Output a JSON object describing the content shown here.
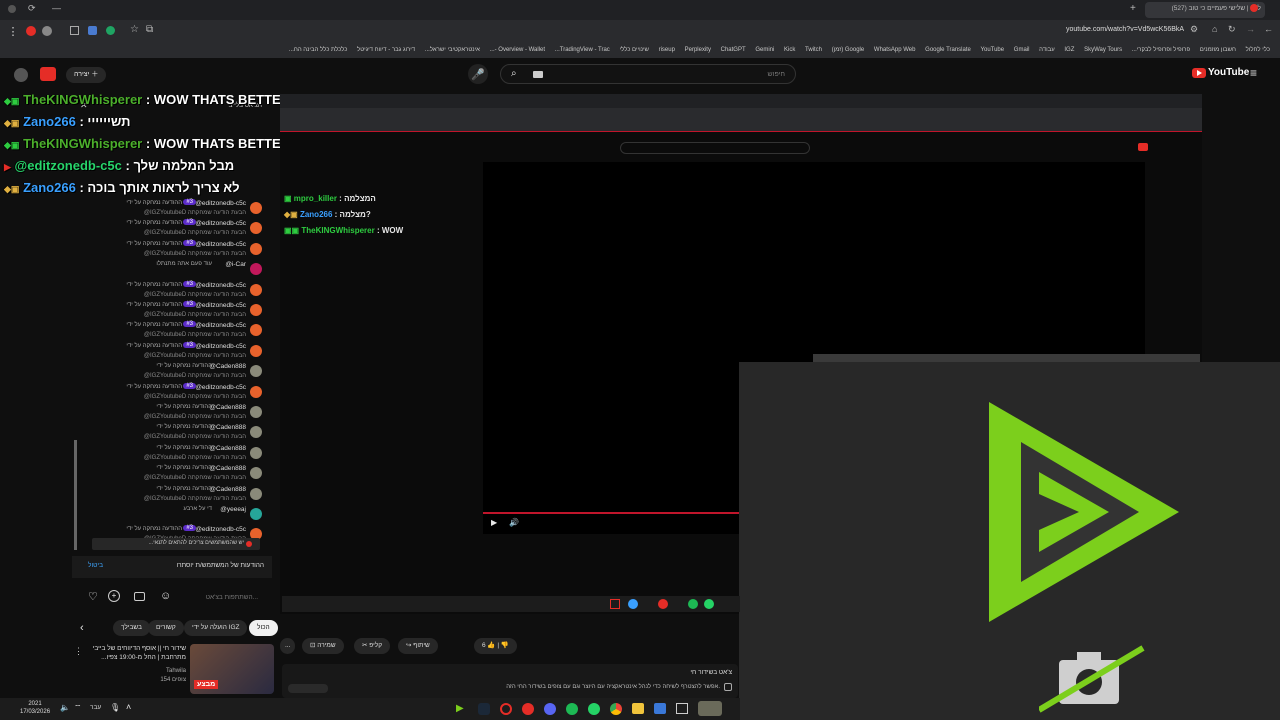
{
  "browser": {
    "tab_title": "לייב | שלישי פעמיים כי טוב (527)",
    "url": "youtube.com/watch?v=Vd5wcK56BkA",
    "bookmarks": [
      "כלי לחלול",
      "חשבון מוזמנים",
      "פרופיל ופרופיל לבקרי...",
      "SkyWay Tours",
      "IGZ",
      "עבודה",
      "Gmail",
      "YouTube",
      "Google Translate",
      "WhatsApp Web",
      "Google (זמן)",
      "Twitch",
      "Kick",
      "Gemini",
      "ChatGPT",
      "Perplexity",
      "riseup",
      "שינויים כללי",
      "TradingView - Trac...",
      "Overview - Wallet -...",
      "אינטראקטיבי ישראל...",
      "דירוג גבר - דיווח דיגיטל",
      "כלכלת כלל הבינה הח..."
    ]
  },
  "youtube": {
    "logo_text": "YouTube",
    "search_placeholder": "חיפוש",
    "create_label": "יצירה"
  },
  "overlay_chat": [
    {
      "name": "TheKINGWhisperer",
      "text": ": WOW THATS BETTER"
    },
    {
      "name": "Zano266",
      "text": ": תשיייייי"
    },
    {
      "name": "TheKINGWhisperer",
      "text": ": WOW THATS BETTER"
    },
    {
      "name": "@editzonedb-c5c",
      "text": ": מבל המלמה שלך"
    },
    {
      "name": "Zano266",
      "text": ": לא צריך לראות אותך בוכה"
    }
  ],
  "chat": {
    "header": "הצ'אט בלייב",
    "messages": [
      {
        "name": "@editzonedb-c5c",
        "badge": "#3",
        "line1": "ההודעה נמחקה על ידי",
        "line2": "@IGZYoutubeD הבעת הודעה שמחקתה"
      },
      {
        "name": "@editzonedb-c5c",
        "badge": "#3",
        "line1": "ההודעה נמחקה על ידי",
        "line2": "@IGZYoutubeD הבעת הודעה שמחקתה"
      },
      {
        "name": "@editzonedb-c5c",
        "badge": "#3",
        "line1": "ההודעה נמחקה על ידי",
        "line2": "@IGZYoutubeD הבעת הודעה שמחקתה"
      },
      {
        "name": "@i-Car",
        "badge": "",
        "line1": "עוד פעם אתה מתנתלו",
        "line2": ""
      },
      {
        "name": "@editzonedb-c5c",
        "badge": "#3",
        "line1": "ההודעה נמחקה על ידי",
        "line2": "@IGZYoutubeD הבעת הודעה שמחקתה"
      },
      {
        "name": "@editzonedb-c5c",
        "badge": "#3",
        "line1": "ההודעה נמחקה על ידי",
        "line2": "@IGZYoutubeD הבעת הודעה שמחקתה"
      },
      {
        "name": "@editzonedb-c5c",
        "badge": "#3",
        "line1": "ההודעה נמחקה על ידי",
        "line2": "@IGZYoutubeD הבעת הודעה שמחקתה"
      },
      {
        "name": "@editzonedb-c5c",
        "badge": "#3",
        "line1": "ההודעה נמחקה על ידי",
        "line2": "@IGZYoutubeD הבעת הודעה שמחקתה"
      },
      {
        "name": "@Caden888",
        "badge": "",
        "line1": "ההודעה נמחקה על ידי",
        "line2": "@IGZYoutubeD הבעת הודעה שמחקתה"
      },
      {
        "name": "@editzonedb-c5c",
        "badge": "#3",
        "line1": "ההודעה נמחקה על ידי",
        "line2": "@IGZYoutubeD הבעת הודעה שמחקתה"
      },
      {
        "name": "@Caden888",
        "badge": "",
        "line1": "ההודעה נמחקה על ידי",
        "line2": "@IGZYoutubeD הבעת הודעה שמחקתה"
      },
      {
        "name": "@Caden888",
        "badge": "",
        "line1": "ההודעה נמחקה על ידי",
        "line2": "@IGZYoutubeD הבעת הודעה שמחקתה"
      },
      {
        "name": "@Caden888",
        "badge": "",
        "line1": "ההודעה נמחקה על ידי",
        "line2": "@IGZYoutubeD הבעת הודעה שמחקתה"
      },
      {
        "name": "@Caden888",
        "badge": "",
        "line1": "ההודעה נמחקה על ידי",
        "line2": "@IGZYoutubeD הבעת הודעה שמחקתה"
      },
      {
        "name": "@Caden888",
        "badge": "",
        "line1": "ההודעה נמחקה על ידי",
        "line2": "@IGZYoutubeD הבעת הודעה שמחקתה"
      },
      {
        "name": "@yeeeaj",
        "badge": "",
        "line1": "די על ארבע",
        "line2": ""
      },
      {
        "name": "@editzonedb-c5c",
        "badge": "#3",
        "line1": "ההודעה נמחקה על ידי",
        "line2": "@IGZYoutubeD הבעת הודעה שמחקתה"
      }
    ],
    "banner": "יש שהמשתמשים צריכים להתאים לתנאי...",
    "notice": "ההודעות של המשתמש/ת יוסתרו",
    "notice_link": "ביטול",
    "input_placeholder": "השתתפות בצ'אט..."
  },
  "inner_chat": [
    {
      "name": "mpro_killer",
      "text": ": המצלמה"
    },
    {
      "name": "Zano266",
      "text": ": מצלמה?"
    },
    {
      "name": "TheKINGWhisperer",
      "text": ": WOW"
    }
  ],
  "actions": {
    "likes": "6",
    "share": "שיתוף",
    "clip": "קליפ",
    "save": "שמירה",
    "more": "..."
  },
  "filters": [
    "הכול",
    "הועלה על ידי IGZ",
    "קשורים",
    "בשבילך"
  ],
  "recommended": {
    "title": "שידור חי || אוסף הדיווחים של בייבי מתרחבת | החל מ-19:00 צפיו...",
    "channel": "Tahwila",
    "views": "154 צופים",
    "thumb_text": "מבצע"
  },
  "description": {
    "line1": "צ'אט בשידור חי",
    "line2": "אפשר להצטרף לשיחה כדי לנהל אינטראקציה עם היוצר וגם עם צופים בשידור החי הזה."
  },
  "clock": {
    "time": "2021",
    "date": "17/03/2026"
  },
  "taskbar_lang": "עבר"
}
